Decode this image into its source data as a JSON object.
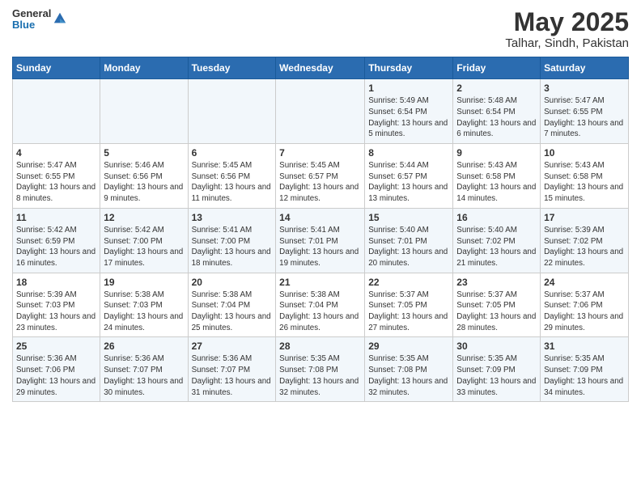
{
  "header": {
    "logo_general": "General",
    "logo_blue": "Blue",
    "title": "May 2025",
    "subtitle": "Talhar, Sindh, Pakistan"
  },
  "columns": [
    "Sunday",
    "Monday",
    "Tuesday",
    "Wednesday",
    "Thursday",
    "Friday",
    "Saturday"
  ],
  "weeks": [
    [
      {
        "day": "",
        "info": ""
      },
      {
        "day": "",
        "info": ""
      },
      {
        "day": "",
        "info": ""
      },
      {
        "day": "",
        "info": ""
      },
      {
        "day": "1",
        "info": "Sunrise: 5:49 AM\nSunset: 6:54 PM\nDaylight: 13 hours and 5 minutes."
      },
      {
        "day": "2",
        "info": "Sunrise: 5:48 AM\nSunset: 6:54 PM\nDaylight: 13 hours and 6 minutes."
      },
      {
        "day": "3",
        "info": "Sunrise: 5:47 AM\nSunset: 6:55 PM\nDaylight: 13 hours and 7 minutes."
      }
    ],
    [
      {
        "day": "4",
        "info": "Sunrise: 5:47 AM\nSunset: 6:55 PM\nDaylight: 13 hours and 8 minutes."
      },
      {
        "day": "5",
        "info": "Sunrise: 5:46 AM\nSunset: 6:56 PM\nDaylight: 13 hours and 9 minutes."
      },
      {
        "day": "6",
        "info": "Sunrise: 5:45 AM\nSunset: 6:56 PM\nDaylight: 13 hours and 11 minutes."
      },
      {
        "day": "7",
        "info": "Sunrise: 5:45 AM\nSunset: 6:57 PM\nDaylight: 13 hours and 12 minutes."
      },
      {
        "day": "8",
        "info": "Sunrise: 5:44 AM\nSunset: 6:57 PM\nDaylight: 13 hours and 13 minutes."
      },
      {
        "day": "9",
        "info": "Sunrise: 5:43 AM\nSunset: 6:58 PM\nDaylight: 13 hours and 14 minutes."
      },
      {
        "day": "10",
        "info": "Sunrise: 5:43 AM\nSunset: 6:58 PM\nDaylight: 13 hours and 15 minutes."
      }
    ],
    [
      {
        "day": "11",
        "info": "Sunrise: 5:42 AM\nSunset: 6:59 PM\nDaylight: 13 hours and 16 minutes."
      },
      {
        "day": "12",
        "info": "Sunrise: 5:42 AM\nSunset: 7:00 PM\nDaylight: 13 hours and 17 minutes."
      },
      {
        "day": "13",
        "info": "Sunrise: 5:41 AM\nSunset: 7:00 PM\nDaylight: 13 hours and 18 minutes."
      },
      {
        "day": "14",
        "info": "Sunrise: 5:41 AM\nSunset: 7:01 PM\nDaylight: 13 hours and 19 minutes."
      },
      {
        "day": "15",
        "info": "Sunrise: 5:40 AM\nSunset: 7:01 PM\nDaylight: 13 hours and 20 minutes."
      },
      {
        "day": "16",
        "info": "Sunrise: 5:40 AM\nSunset: 7:02 PM\nDaylight: 13 hours and 21 minutes."
      },
      {
        "day": "17",
        "info": "Sunrise: 5:39 AM\nSunset: 7:02 PM\nDaylight: 13 hours and 22 minutes."
      }
    ],
    [
      {
        "day": "18",
        "info": "Sunrise: 5:39 AM\nSunset: 7:03 PM\nDaylight: 13 hours and 23 minutes."
      },
      {
        "day": "19",
        "info": "Sunrise: 5:38 AM\nSunset: 7:03 PM\nDaylight: 13 hours and 24 minutes."
      },
      {
        "day": "20",
        "info": "Sunrise: 5:38 AM\nSunset: 7:04 PM\nDaylight: 13 hours and 25 minutes."
      },
      {
        "day": "21",
        "info": "Sunrise: 5:38 AM\nSunset: 7:04 PM\nDaylight: 13 hours and 26 minutes."
      },
      {
        "day": "22",
        "info": "Sunrise: 5:37 AM\nSunset: 7:05 PM\nDaylight: 13 hours and 27 minutes."
      },
      {
        "day": "23",
        "info": "Sunrise: 5:37 AM\nSunset: 7:05 PM\nDaylight: 13 hours and 28 minutes."
      },
      {
        "day": "24",
        "info": "Sunrise: 5:37 AM\nSunset: 7:06 PM\nDaylight: 13 hours and 29 minutes."
      }
    ],
    [
      {
        "day": "25",
        "info": "Sunrise: 5:36 AM\nSunset: 7:06 PM\nDaylight: 13 hours and 29 minutes."
      },
      {
        "day": "26",
        "info": "Sunrise: 5:36 AM\nSunset: 7:07 PM\nDaylight: 13 hours and 30 minutes."
      },
      {
        "day": "27",
        "info": "Sunrise: 5:36 AM\nSunset: 7:07 PM\nDaylight: 13 hours and 31 minutes."
      },
      {
        "day": "28",
        "info": "Sunrise: 5:35 AM\nSunset: 7:08 PM\nDaylight: 13 hours and 32 minutes."
      },
      {
        "day": "29",
        "info": "Sunrise: 5:35 AM\nSunset: 7:08 PM\nDaylight: 13 hours and 32 minutes."
      },
      {
        "day": "30",
        "info": "Sunrise: 5:35 AM\nSunset: 7:09 PM\nDaylight: 13 hours and 33 minutes."
      },
      {
        "day": "31",
        "info": "Sunrise: 5:35 AM\nSunset: 7:09 PM\nDaylight: 13 hours and 34 minutes."
      }
    ]
  ]
}
